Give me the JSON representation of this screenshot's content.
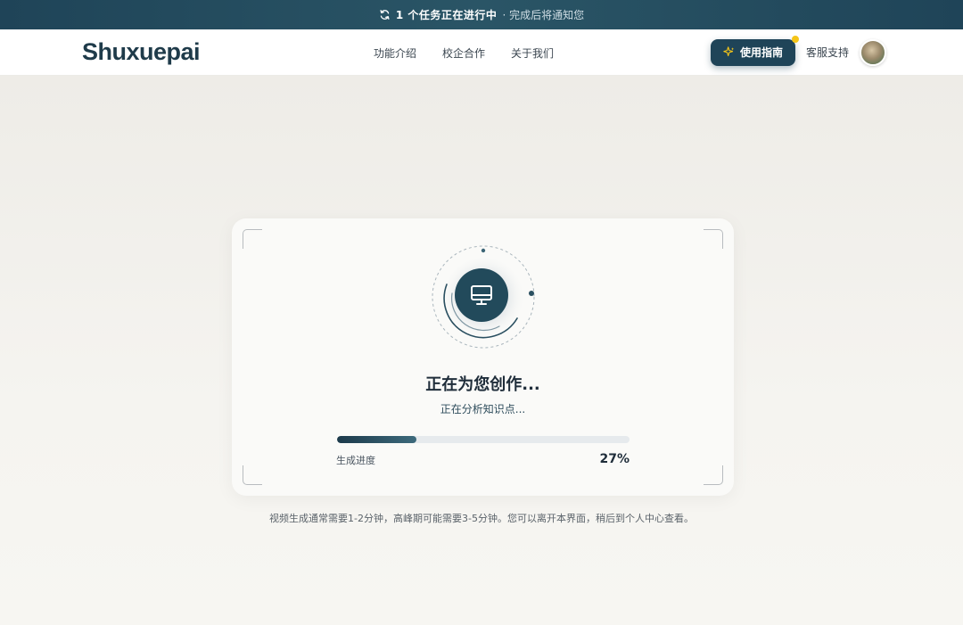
{
  "banner": {
    "main": "1 个任务正在进行中",
    "sub": "· 完成后将通知您"
  },
  "nav": {
    "logo": "Shuxuepai",
    "links": [
      "功能介绍",
      "校企合作",
      "关于我们"
    ],
    "guide_label": "使用指南",
    "support_label": "客服支持"
  },
  "card": {
    "title": "正在为您创作...",
    "subtitle": "正在分析知识点...",
    "progress_label": "生成进度",
    "progress_value": "27%",
    "progress_fraction": 0.27
  },
  "footnote": "视频生成通常需要1-2分钟，高峰期可能需要3-5分钟。您可以离开本界面，稍后到个人中心查看。",
  "colors": {
    "brand_dark": "#1f4458",
    "accent_dot": "#f5c518"
  }
}
